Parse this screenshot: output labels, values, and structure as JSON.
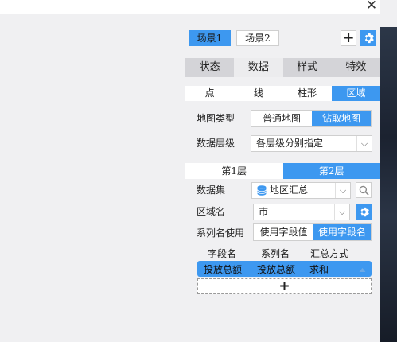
{
  "window": {
    "close_glyph": "✕"
  },
  "scenes": [
    {
      "label": "场景1"
    },
    {
      "label": "场景2"
    }
  ],
  "scene_toolbar": {
    "add_icon": "plus-icon",
    "settings_icon": "gear-icon"
  },
  "tabs": [
    {
      "label": "状态"
    },
    {
      "label": "数据"
    },
    {
      "label": "样式"
    },
    {
      "label": "特效"
    }
  ],
  "subtabs": [
    {
      "label": "点"
    },
    {
      "label": "线"
    },
    {
      "label": "柱形"
    },
    {
      "label": "区域"
    }
  ],
  "map_type": {
    "label": "地图类型",
    "options": [
      {
        "label": "普通地图"
      },
      {
        "label": "钻取地图"
      }
    ]
  },
  "data_level": {
    "label": "数据层级",
    "value": "各层级分别指定"
  },
  "layers": [
    {
      "label": "第1层"
    },
    {
      "label": "第2层"
    }
  ],
  "dataset": {
    "label": "数据集",
    "value": "地区汇总",
    "icon": "database-icon",
    "search_icon": "search-icon"
  },
  "region": {
    "label": "区域名",
    "value": "市",
    "settings_icon": "gear-icon"
  },
  "series_name": {
    "label": "系列名使用",
    "options": [
      {
        "label": "使用字段值"
      },
      {
        "label": "使用字段名"
      }
    ]
  },
  "fields_table": {
    "headers": [
      "字段名",
      "系列名",
      "汇总方式"
    ],
    "rows": [
      {
        "field": "投放总额",
        "series": "投放总额",
        "summary": "求和"
      }
    ],
    "add_glyph": "+"
  },
  "colors": {
    "accent": "#3d98f0",
    "panel": "#f0f0f2"
  }
}
